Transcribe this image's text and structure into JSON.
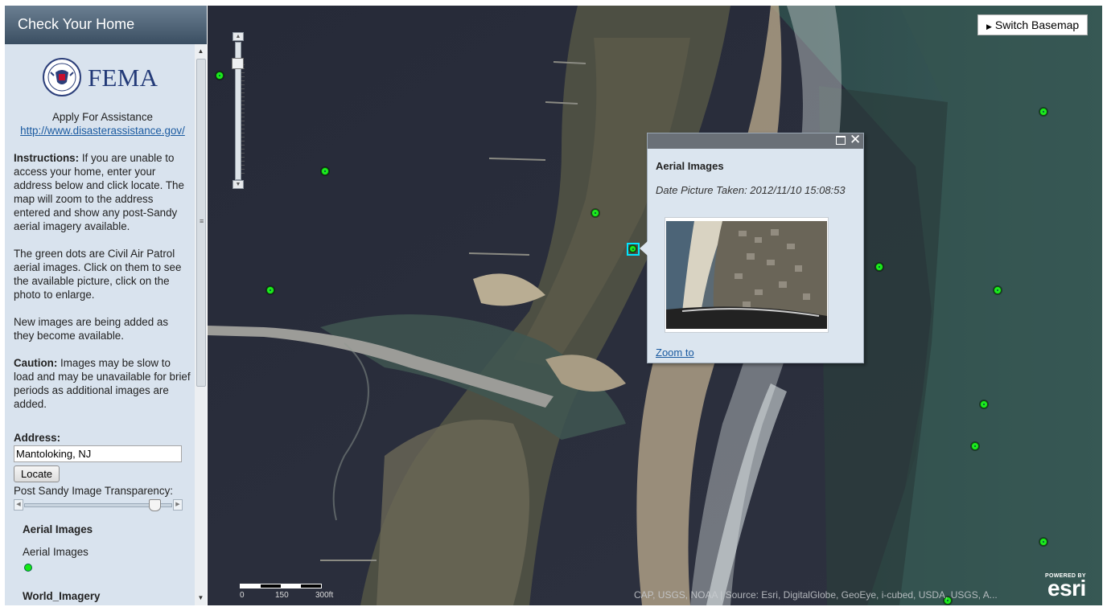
{
  "sidebar": {
    "title": "Check Your Home",
    "logo_text": "FEMA",
    "apply_text": "Apply For Assistance",
    "apply_link": "http://www.disasterassistance.gov/",
    "instructions_label": "Instructions:",
    "instructions_text": " If you are unable to access your home, enter your address below and click locate. The map will zoom to the address entered and show any post-Sandy aerial imagery available.",
    "green_dots_text": "The green dots are Civil Air Patrol aerial images. Click on them to see the available picture, click on the photo to enlarge.",
    "new_images_text": "New images are being added as they become available.",
    "caution_label": "Caution:",
    "caution_text": " Images may be slow to load and may be unavailable for brief periods as additional images are added.",
    "address_label": "Address:",
    "address_value": "Mantoloking, NJ",
    "locate_label": "Locate",
    "transparency_label": "Post Sandy Image Transparency:",
    "transparency_value": 0.92,
    "legend_title": "Aerial Images",
    "legend_sub": "Aerial Images",
    "world_label": "World_Imagery"
  },
  "map": {
    "basemap_button": "Switch Basemap",
    "popup": {
      "title": "Aerial Images",
      "date": "Date Picture Taken: 2012/11/10 15:08:53",
      "zoom_link": "Zoom to"
    },
    "scale_labels": [
      "0",
      "150",
      "300ft"
    ],
    "attribution": "CAP, USGS, NOAA | Source: Esri, DigitalGlobe, GeoEye, i-cubed, USDA, USGS, A...",
    "logo_powered": "POWERED BY",
    "logo_name": "esri",
    "dot_color": "#1dea1d"
  }
}
